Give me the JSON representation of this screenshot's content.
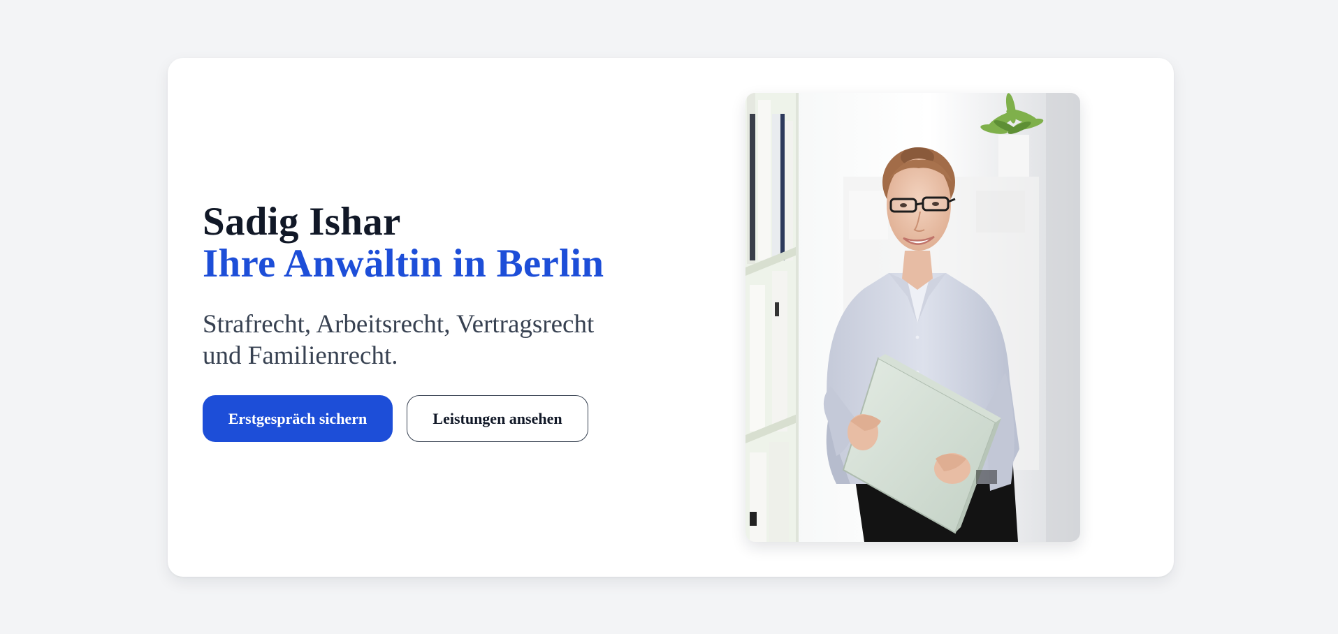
{
  "hero": {
    "name": "Sadig Ishar",
    "tagline": "Ihre Anwältin in Berlin",
    "subtitle": "Strafrecht, Arbeitsrecht, Vertragsrecht und Familienrecht.",
    "primary_button": "Erstgespräch sichern",
    "secondary_button": "Leistungen ansehen"
  },
  "colors": {
    "background": "#f3f4f6",
    "card": "#ffffff",
    "accent": "#1d4ed8",
    "heading": "#111827",
    "body_text": "#374151"
  }
}
